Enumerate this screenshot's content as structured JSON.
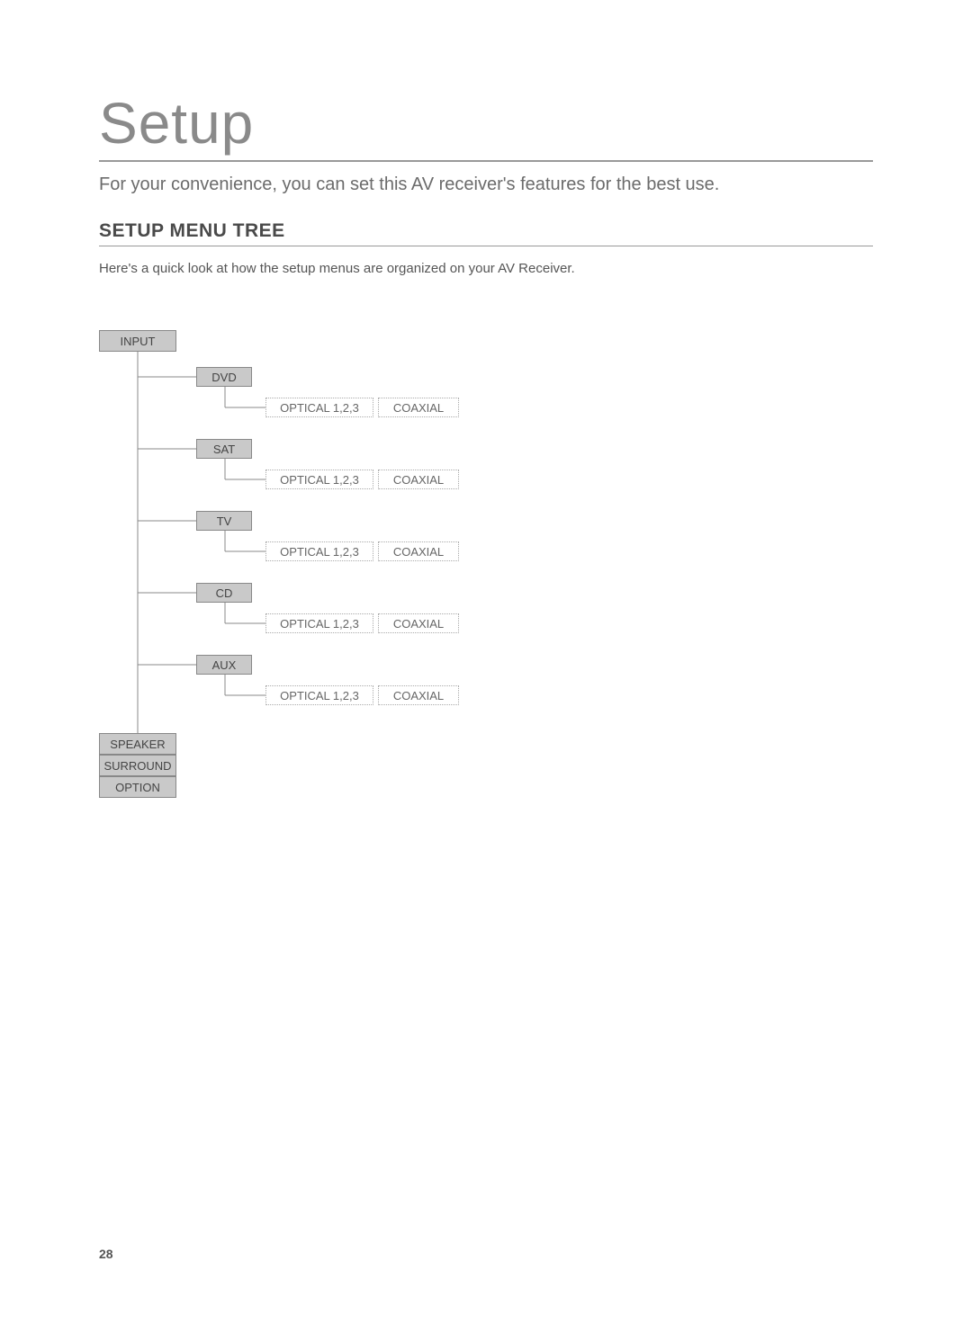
{
  "title": "Setup",
  "intro": "For your convenience, you can set this AV receiver's features for the best use.",
  "section_heading": "SETUP MENU TREE",
  "desc": "Here's a quick look at how the setup menus are organized on your AV Receiver.",
  "page_number": "28",
  "tree": {
    "l1": {
      "input": "INPUT",
      "speaker": "SPEAKER",
      "surround": "SURROUND",
      "option": "OPTION"
    },
    "l2": {
      "dvd": "DVD",
      "sat": "SAT",
      "tv": "TV",
      "cd": "CD",
      "aux": "AUX"
    },
    "l3": {
      "optical": "OPTICAL 1,2,3",
      "coaxial": "COAXIAL"
    }
  }
}
